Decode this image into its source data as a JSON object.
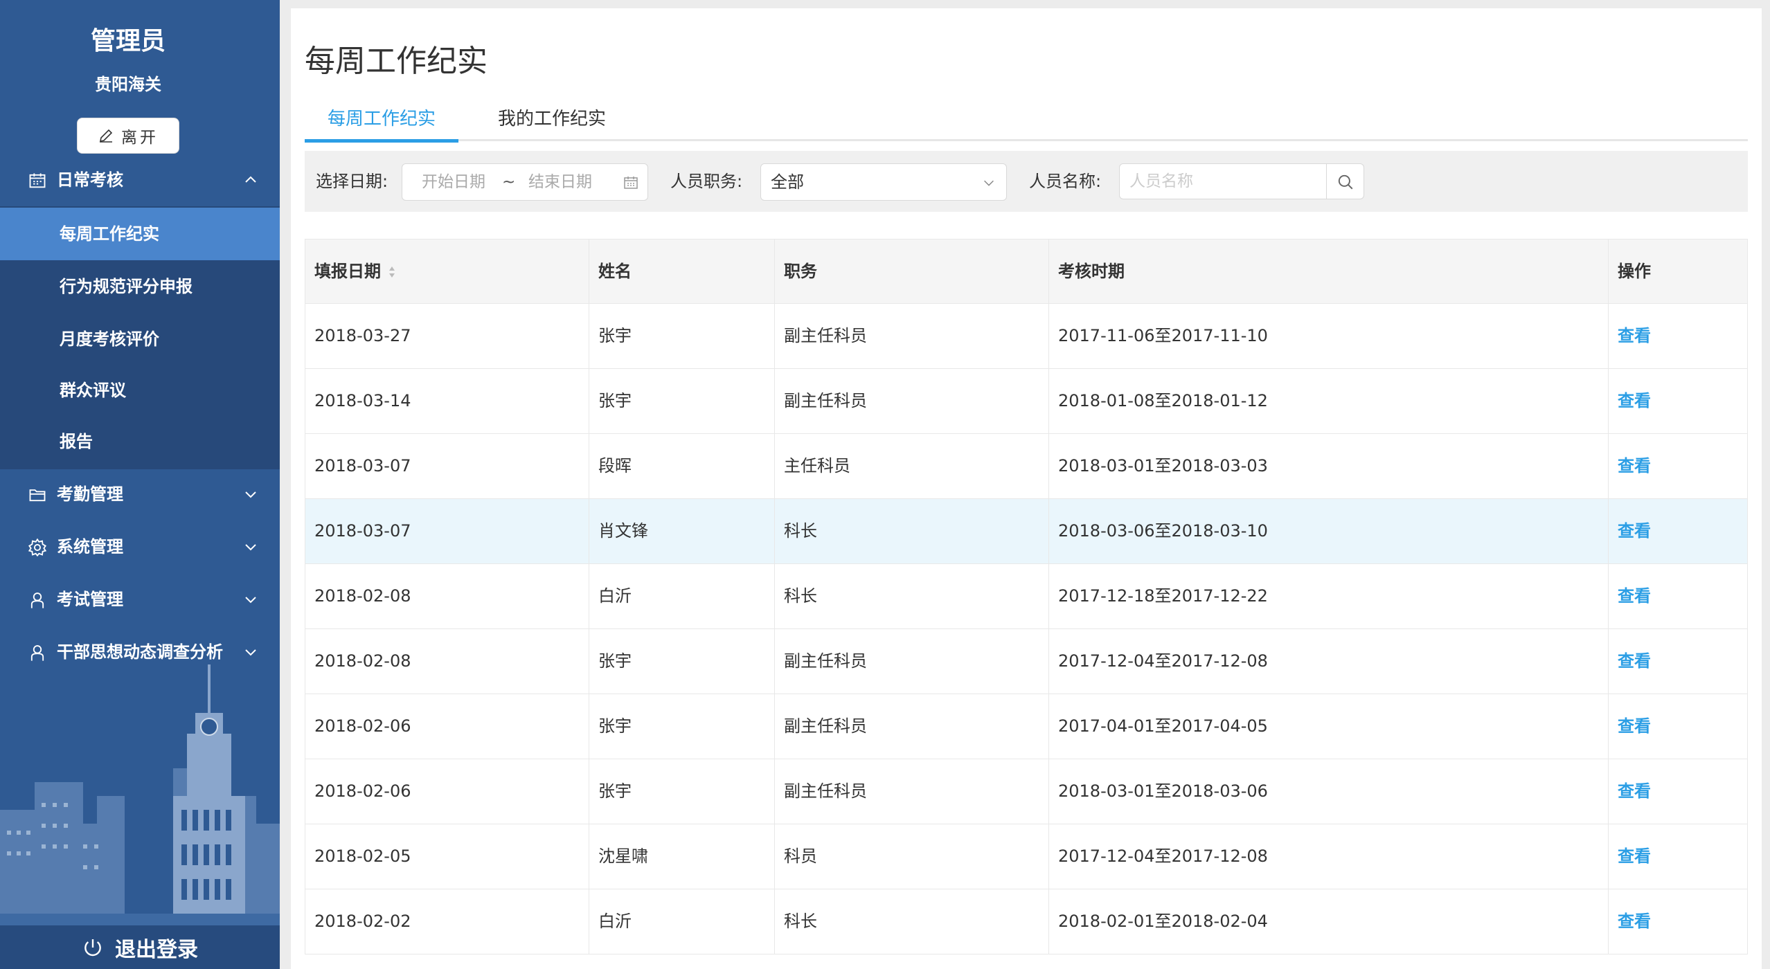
{
  "sidebar": {
    "title": "管理员",
    "org": "贵阳海关",
    "leave_label": "离开",
    "groups": [
      {
        "label": "日常考核",
        "icon": "calendar-icon",
        "expanded": true
      },
      {
        "label": "考勤管理",
        "icon": "folder-icon",
        "expanded": false
      },
      {
        "label": "系统管理",
        "icon": "gear-icon",
        "expanded": false
      },
      {
        "label": "考试管理",
        "icon": "user-icon",
        "expanded": false
      },
      {
        "label": "干部思想动态调查分析",
        "icon": "user-icon",
        "expanded": false
      }
    ],
    "sub_items": [
      {
        "label": "每周工作纪实",
        "active": true
      },
      {
        "label": "行为规范评分申报",
        "active": false
      },
      {
        "label": "月度考核评价",
        "active": false
      },
      {
        "label": "群众评议",
        "active": false
      },
      {
        "label": "报告",
        "active": false
      }
    ],
    "logout_label": "退出登录"
  },
  "page": {
    "title": "每周工作纪实",
    "tabs": [
      {
        "label": "每周工作纪实",
        "active": true
      },
      {
        "label": "我的工作纪实",
        "active": false
      }
    ]
  },
  "filter": {
    "date_label": "选择日期:",
    "start_placeholder": "开始日期",
    "separator": "~",
    "end_placeholder": "结束日期",
    "role_label": "人员职务:",
    "role_value": "全部",
    "name_label": "人员名称:",
    "name_placeholder": "人员名称"
  },
  "table": {
    "columns": [
      "填报日期",
      "姓名",
      "职务",
      "考核时期",
      "操作"
    ],
    "action_label": "查看",
    "rows": [
      [
        "2018-03-27",
        "张宇",
        "副主任科员",
        "2017-11-06至2017-11-10"
      ],
      [
        "2018-03-14",
        "张宇",
        "副主任科员",
        "2018-01-08至2018-01-12"
      ],
      [
        "2018-03-07",
        "段晖",
        "主任科员",
        "2018-03-01至2018-03-03"
      ],
      [
        "2018-03-07",
        "肖文锋",
        "科长",
        "2018-03-06至2018-03-10"
      ],
      [
        "2018-02-08",
        "白沂",
        "科长",
        "2017-12-18至2017-12-22"
      ],
      [
        "2018-02-08",
        "张宇",
        "副主任科员",
        "2017-12-04至2017-12-08"
      ],
      [
        "2018-02-06",
        "张宇",
        "副主任科员",
        "2017-04-01至2017-04-05"
      ],
      [
        "2018-02-06",
        "张宇",
        "副主任科员",
        "2018-03-01至2018-03-06"
      ],
      [
        "2018-02-05",
        "沈星啸",
        "科员",
        "2017-12-04至2017-12-08"
      ],
      [
        "2018-02-02",
        "白沂",
        "科长",
        "2018-02-01至2018-02-04"
      ]
    ]
  },
  "colors": {
    "sidebar_bg": "#2f5a93",
    "submenu_bg": "#27497a",
    "active_item": "#4a85cc",
    "accent": "#2b9ee5",
    "row_hover": "#eaf6fc"
  }
}
